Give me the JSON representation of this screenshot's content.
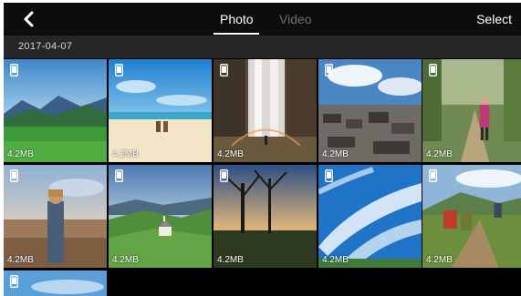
{
  "header": {
    "back_icon": "chevron-left-icon",
    "tabs": [
      {
        "label": "Photo",
        "active": true
      },
      {
        "label": "Video",
        "active": false
      }
    ],
    "select_label": "Select"
  },
  "section": {
    "date": "2017-04-07"
  },
  "photos": [
    {
      "size": "4.2MB",
      "scene": "mountain-lake-meadow"
    },
    {
      "size": "4.2MB",
      "scene": "beach-couple"
    },
    {
      "size": "4.2MB",
      "scene": "waterfall-rainbow"
    },
    {
      "size": "4.2MB",
      "scene": "old-town-rooftops"
    },
    {
      "size": "4.2MB",
      "scene": "woman-walking-path"
    },
    {
      "size": "4.2MB",
      "scene": "woman-field-sunset"
    },
    {
      "size": "4.2MB",
      "scene": "church-green-hills"
    },
    {
      "size": "4.2MB",
      "scene": "bare-trees-sunset"
    },
    {
      "size": "4.2MB",
      "scene": "blue-sky-clouds"
    },
    {
      "size": "4.2MB",
      "scene": "hikers-trail"
    },
    {
      "size": "",
      "scene": "blue-sky-partial"
    }
  ],
  "colors": {
    "background": "#000000",
    "topbar": "#0d0d0d",
    "date_header": "#262626",
    "active_tab": "#ffffff",
    "inactive_tab": "#6f6f6f"
  }
}
